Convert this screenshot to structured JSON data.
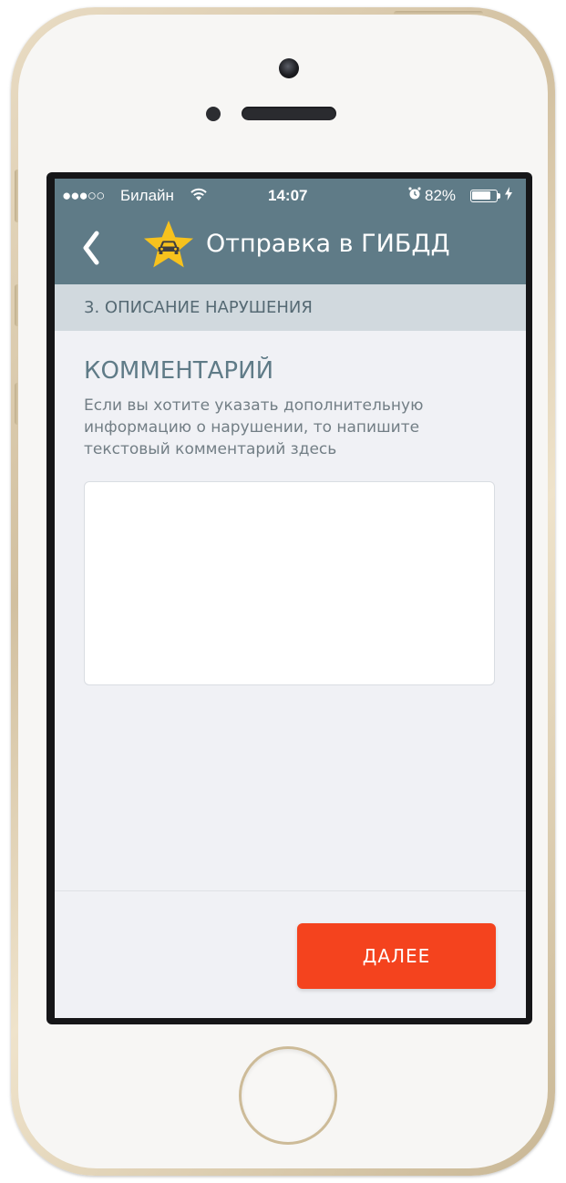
{
  "status_bar": {
    "signal": "●●●○○",
    "carrier": "Билайн",
    "time": "14:07",
    "battery_percent": "82%",
    "battery_level": 0.82
  },
  "nav": {
    "title": "Отправка в ГИБДД"
  },
  "section": {
    "label": "3. ОПИСАНИЕ НАРУШЕНИЯ"
  },
  "content": {
    "title": "КОММЕНТАРИЙ",
    "description_lines": [
      "Если вы хотите указать дополнительную",
      "информацию о нарушении, то напишите",
      "текстовый комментарий здесь"
    ],
    "comment_value": ""
  },
  "actions": {
    "next_label": "ДАЛЕЕ"
  },
  "colors": {
    "nav_bg": "#5f7b87",
    "section_bg": "#d1d9de",
    "accent": "#f4431e",
    "star": "#f7c21d"
  },
  "icons": {
    "back": "chevron-left-icon",
    "logo": "star-car-icon",
    "wifi": "wifi-icon",
    "alarm": "alarm-icon",
    "battery": "battery-icon",
    "charging": "bolt-icon"
  }
}
